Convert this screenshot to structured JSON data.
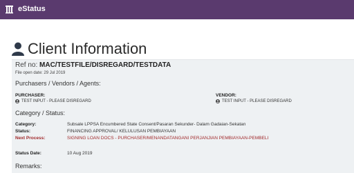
{
  "app": {
    "name": "eStatus"
  },
  "page": {
    "title": "Client Information"
  },
  "ref": {
    "label": "Ref no:",
    "value": "MAC/TESTFILE/DISREGARD/TESTDATA",
    "open_date": "File open date: 29 Jul 2019"
  },
  "parties": {
    "heading": "Purchasers / Vendors / Agents:",
    "purchaser_label": "PURCHASER:",
    "purchaser_value": "TEST INPUT - PLEASE DISREGARD",
    "vendor_label": "VENDOR:",
    "vendor_value": "TEST INPUT - PLEASE DISREGARD"
  },
  "category_section": {
    "heading": "Category / Status:",
    "category_label": "Category:",
    "category_value": "Subsale LPPSA Encumbered State Consent/Pasaran Sekunder- Dalam Gadaian-Sekatan",
    "status_label": "Status:",
    "status_value": "FINANCING APPROVAL/ KELULUSAN PEMBIAYAAN",
    "next_label": "Next Process:",
    "next_value": "SIGNING LOAN DOCS - PURCHASER/MENANDATANGANI PERJANJIAN PEMBIAYAAN-PEMBELI",
    "date_label": "Status Date:",
    "date_value": "10 Aug 2019"
  },
  "remarks": {
    "heading": "Remarks:"
  },
  "colors": {
    "topbar": "#5a3a6e",
    "accent_red": "#a0282a",
    "panel": "#eef1f3"
  },
  "icons": {
    "brand": "building-icon",
    "title": "user-icon",
    "party": "user-circle-icon"
  }
}
